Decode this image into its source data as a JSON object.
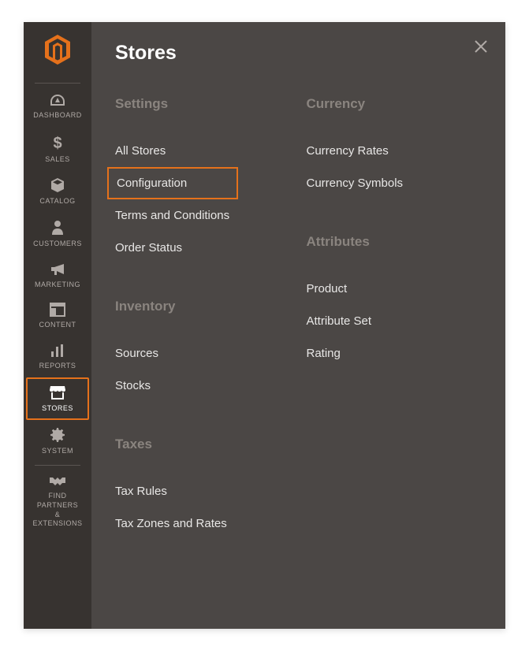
{
  "flyout": {
    "title": "Stores",
    "columns": [
      [
        {
          "title": "Settings",
          "items": [
            {
              "label": "All Stores",
              "highlighted": false
            },
            {
              "label": "Configuration",
              "highlighted": true
            },
            {
              "label": "Terms and Conditions",
              "highlighted": false
            },
            {
              "label": "Order Status",
              "highlighted": false
            }
          ]
        },
        {
          "title": "Inventory",
          "items": [
            {
              "label": "Sources",
              "highlighted": false
            },
            {
              "label": "Stocks",
              "highlighted": false
            }
          ]
        },
        {
          "title": "Taxes",
          "items": [
            {
              "label": "Tax Rules",
              "highlighted": false
            },
            {
              "label": "Tax Zones and Rates",
              "highlighted": false
            }
          ]
        }
      ],
      [
        {
          "title": "Currency",
          "items": [
            {
              "label": "Currency Rates",
              "highlighted": false
            },
            {
              "label": "Currency Symbols",
              "highlighted": false
            }
          ]
        },
        {
          "title": "Attributes",
          "items": [
            {
              "label": "Product",
              "highlighted": false
            },
            {
              "label": "Attribute Set",
              "highlighted": false
            },
            {
              "label": "Rating",
              "highlighted": false
            }
          ]
        }
      ]
    ]
  },
  "sidebar": {
    "items": [
      {
        "label": "DASHBOARD",
        "name": "sidebar-item-dashboard",
        "active": false
      },
      {
        "label": "SALES",
        "name": "sidebar-item-sales",
        "active": false
      },
      {
        "label": "CATALOG",
        "name": "sidebar-item-catalog",
        "active": false
      },
      {
        "label": "CUSTOMERS",
        "name": "sidebar-item-customers",
        "active": false
      },
      {
        "label": "MARKETING",
        "name": "sidebar-item-marketing",
        "active": false
      },
      {
        "label": "CONTENT",
        "name": "sidebar-item-content",
        "active": false
      },
      {
        "label": "REPORTS",
        "name": "sidebar-item-reports",
        "active": false
      },
      {
        "label": "STORES",
        "name": "sidebar-item-stores",
        "active": true
      },
      {
        "label": "SYSTEM",
        "name": "sidebar-item-system",
        "active": false
      },
      {
        "label": "FIND PARTNERS\n& EXTENSIONS",
        "name": "sidebar-item-partners",
        "active": false
      }
    ]
  }
}
